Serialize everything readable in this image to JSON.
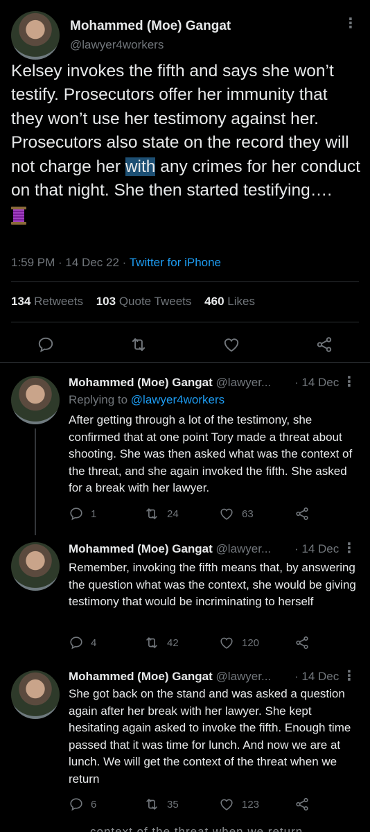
{
  "main": {
    "author_name": "Mohammed (Moe) Gangat",
    "handle": "@lawyer4workers",
    "text_before": "Kelsey invokes the fifth and says she won’t testify.  Prosecutors offer her immunity that they won’t use her testimony against her.  Prosecutors also state on the record they will not charge her ",
    "text_highlight": "with",
    "text_after": " any crimes for her conduct on that night.  She then started testifying….",
    "emoji": "thread-spool-emoji",
    "time": "1:59 PM",
    "date": "14 Dec 22",
    "app": "Twitter for iPhone",
    "retweets_count": "134",
    "retweets_label": "Retweets",
    "quotes_count": "103",
    "quotes_label": "Quote Tweets",
    "likes_count": "460",
    "likes_label": "Likes"
  },
  "replies": [
    {
      "author_name": "Mohammed (Moe) Gangat",
      "handle": "@lawyer...",
      "date": "· 14 Dec",
      "replying_prefix": "Replying to ",
      "replying_handle": "@lawyer4workers",
      "text": "After getting through a lot of the testimony, she confirmed that at one point Tory made a threat about shooting.  She was then asked what was the context of the threat, and she again invoked the fifth. She asked for a break with her lawyer.",
      "reply_count": "1",
      "retweet_count": "24",
      "like_count": "63"
    },
    {
      "author_name": "Mohammed (Moe) Gangat",
      "handle": "@lawyer...",
      "date": "· 14 Dec",
      "text": "Remember, invoking the fifth means that, by answering the question what was the context, she would be giving testimony that would be incriminating to herself",
      "reply_count": "4",
      "retweet_count": "42",
      "like_count": "120"
    },
    {
      "author_name": "Mohammed (Moe) Gangat",
      "handle": "@lawyer...",
      "date": "· 14 Dec",
      "text": "She got back on the stand and was asked a question again after her break with her lawyer. She kept hesitating again asked to invoke the fifth. Enough time passed that it was time for lunch. And now we are at lunch. We will get the context of the threat when we return",
      "reply_count": "6",
      "retweet_count": "35",
      "like_count": "123"
    }
  ],
  "cut_off_text": "context of the threat when we return",
  "colors": {
    "background": "#000000",
    "text": "#e7e9ea",
    "secondary": "#71767b",
    "accent": "#1d9bf0",
    "divider": "#2f3336",
    "highlight": "#1d4f73"
  },
  "icons": [
    "more-icon",
    "reply-icon",
    "retweet-icon",
    "like-icon",
    "share-icon"
  ]
}
